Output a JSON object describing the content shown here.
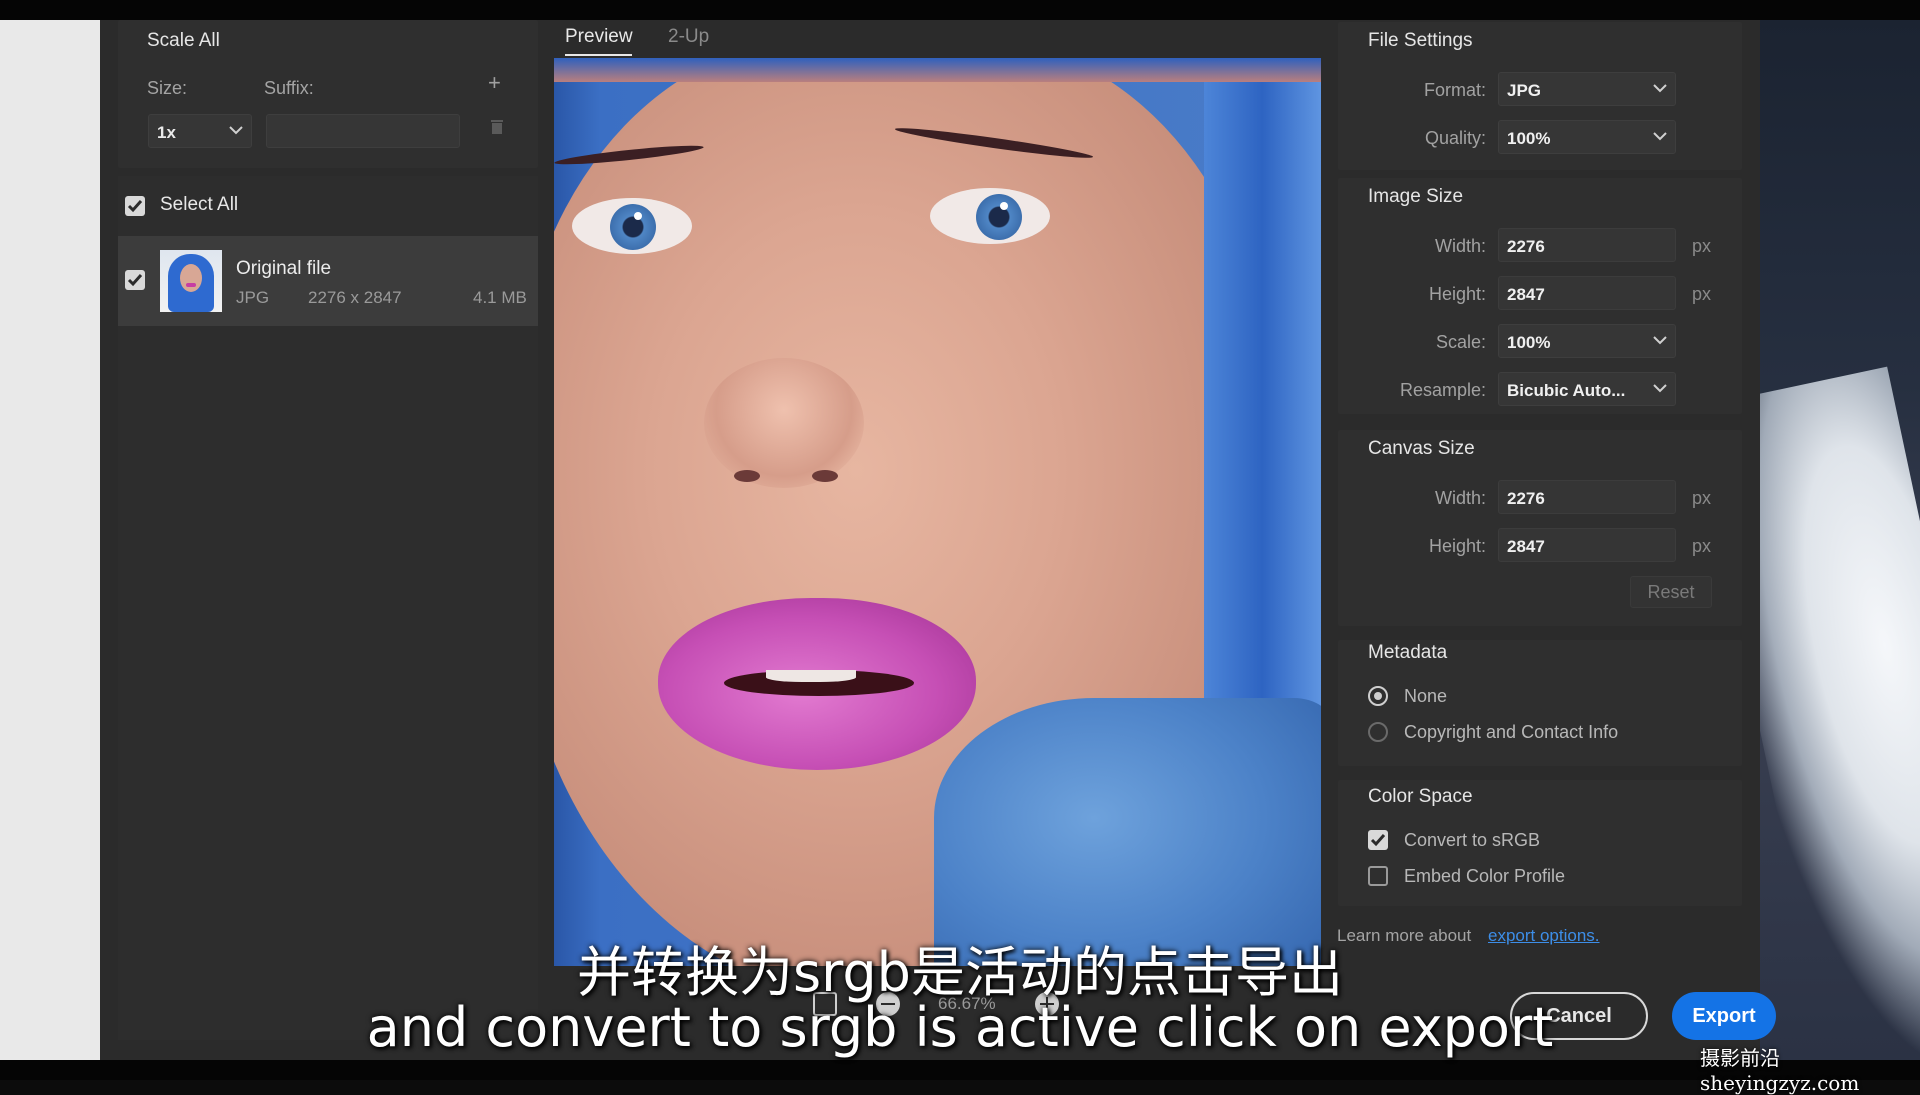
{
  "left_panel": {
    "scale_all_label": "Scale All",
    "size_label": "Size:",
    "suffix_label": "Suffix:",
    "size_value": "1x",
    "suffix_value": "",
    "select_all_label": "Select All",
    "select_all_checked": true,
    "file": {
      "name": "Original file",
      "type": "JPG",
      "dimensions": "2276 x 2847",
      "size": "4.1 MB",
      "checked": true
    }
  },
  "preview": {
    "tabs": [
      "Preview",
      "2-Up"
    ],
    "active_tab": "Preview",
    "zoom": "66.67%"
  },
  "file_settings": {
    "title": "File Settings",
    "format_label": "Format:",
    "format_value": "JPG",
    "quality_label": "Quality:",
    "quality_value": "100%"
  },
  "image_size": {
    "title": "Image Size",
    "width_label": "Width:",
    "width_value": "2276",
    "height_label": "Height:",
    "height_value": "2847",
    "unit": "px",
    "scale_label": "Scale:",
    "scale_value": "100%",
    "resample_label": "Resample:",
    "resample_value": "Bicubic Auto..."
  },
  "canvas_size": {
    "title": "Canvas Size",
    "width_label": "Width:",
    "width_value": "2276",
    "height_label": "Height:",
    "height_value": "2847",
    "unit": "px",
    "reset_label": "Reset"
  },
  "metadata": {
    "title": "Metadata",
    "options": [
      "None",
      "Copyright and Contact Info"
    ],
    "selected": "None"
  },
  "color_space": {
    "title": "Color Space",
    "convert_label": "Convert to sRGB",
    "convert_checked": true,
    "embed_label": "Embed Color Profile",
    "embed_checked": false
  },
  "footer": {
    "learn_more": "Learn more about",
    "learn_link": "export options.",
    "cancel_label": "Cancel",
    "export_label": "Export"
  },
  "subtitles": {
    "chinese": "并转换为srgb是活动的点击导出",
    "english": "and convert to srgb is active click on export"
  },
  "watermark": "摄影前沿sheyingzyz.com",
  "colors": {
    "accent": "#1473e6",
    "panel_bg": "#2b2b2b",
    "link": "#3d8ee8"
  }
}
